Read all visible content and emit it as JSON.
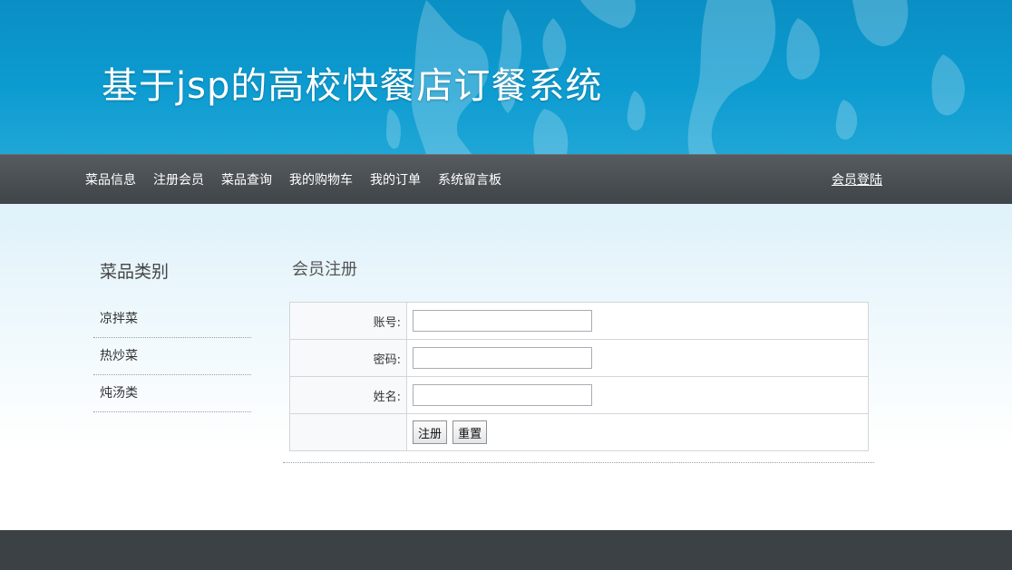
{
  "header": {
    "site_title": "基于jsp的高校快餐店订餐系统"
  },
  "nav": {
    "items": [
      {
        "label": "菜品信息"
      },
      {
        "label": "注册会员"
      },
      {
        "label": "菜品查询"
      },
      {
        "label": "我的购物车"
      },
      {
        "label": "我的订单"
      },
      {
        "label": "系统留言板"
      }
    ],
    "login_label": "会员登陆"
  },
  "sidebar": {
    "title": "菜品类别",
    "categories": [
      {
        "label": "凉拌菜"
      },
      {
        "label": "热炒菜"
      },
      {
        "label": "炖汤类"
      }
    ]
  },
  "register": {
    "title": "会员注册",
    "fields": [
      {
        "label": "账号:",
        "value": ""
      },
      {
        "label": "密码:",
        "value": ""
      },
      {
        "label": "姓名:",
        "value": ""
      }
    ],
    "submit_label": "注册",
    "reset_label": "重置"
  },
  "colors": {
    "banner": "#0c9bd0",
    "navbar": "#4a4f54",
    "footer": "#3c4145"
  }
}
